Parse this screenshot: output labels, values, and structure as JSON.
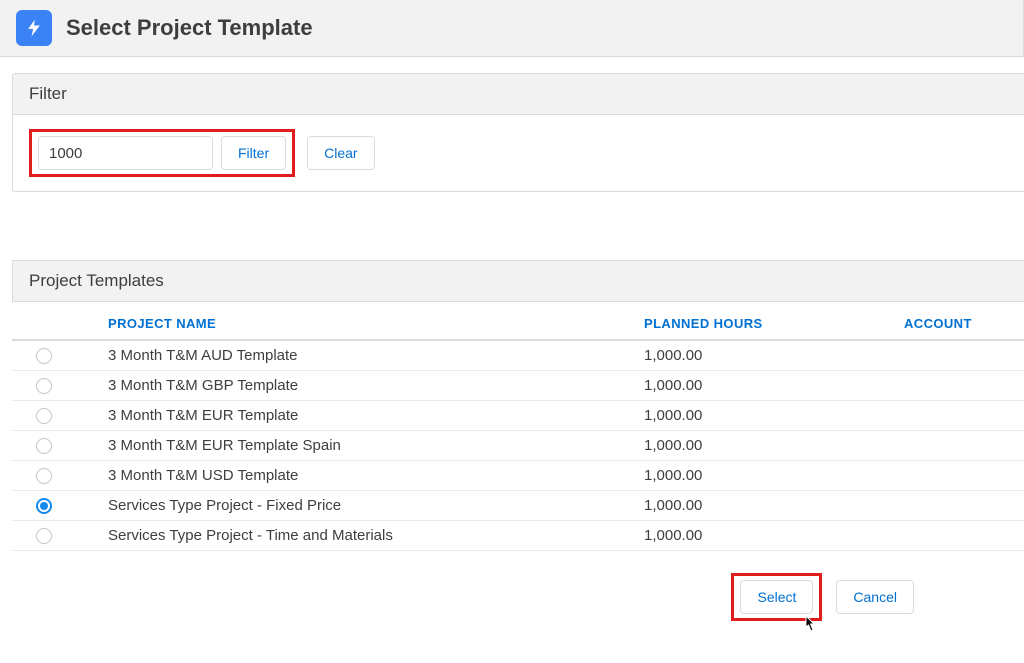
{
  "header": {
    "title": "Select Project Template"
  },
  "filter": {
    "panel_title": "Filter",
    "input_value": "1000",
    "filter_button": "Filter",
    "clear_button": "Clear"
  },
  "templates": {
    "panel_title": "Project Templates",
    "columns": {
      "name": "PROJECT NAME",
      "hours": "PLANNED HOURS",
      "account": "ACCOUNT"
    },
    "rows": [
      {
        "name": "3 Month T&M AUD Template",
        "hours": "1,000.00",
        "account": "",
        "selected": false
      },
      {
        "name": "3 Month T&M GBP Template",
        "hours": "1,000.00",
        "account": "",
        "selected": false
      },
      {
        "name": "3 Month T&M EUR Template",
        "hours": "1,000.00",
        "account": "",
        "selected": false
      },
      {
        "name": "3 Month T&M EUR Template Spain",
        "hours": "1,000.00",
        "account": "",
        "selected": false
      },
      {
        "name": "3 Month T&M USD Template",
        "hours": "1,000.00",
        "account": "",
        "selected": false
      },
      {
        "name": "Services Type Project - Fixed Price",
        "hours": "1,000.00",
        "account": "",
        "selected": true
      },
      {
        "name": "Services Type Project - Time and Materials",
        "hours": "1,000.00",
        "account": "",
        "selected": false
      }
    ]
  },
  "footer": {
    "select_button": "Select",
    "cancel_button": "Cancel"
  }
}
